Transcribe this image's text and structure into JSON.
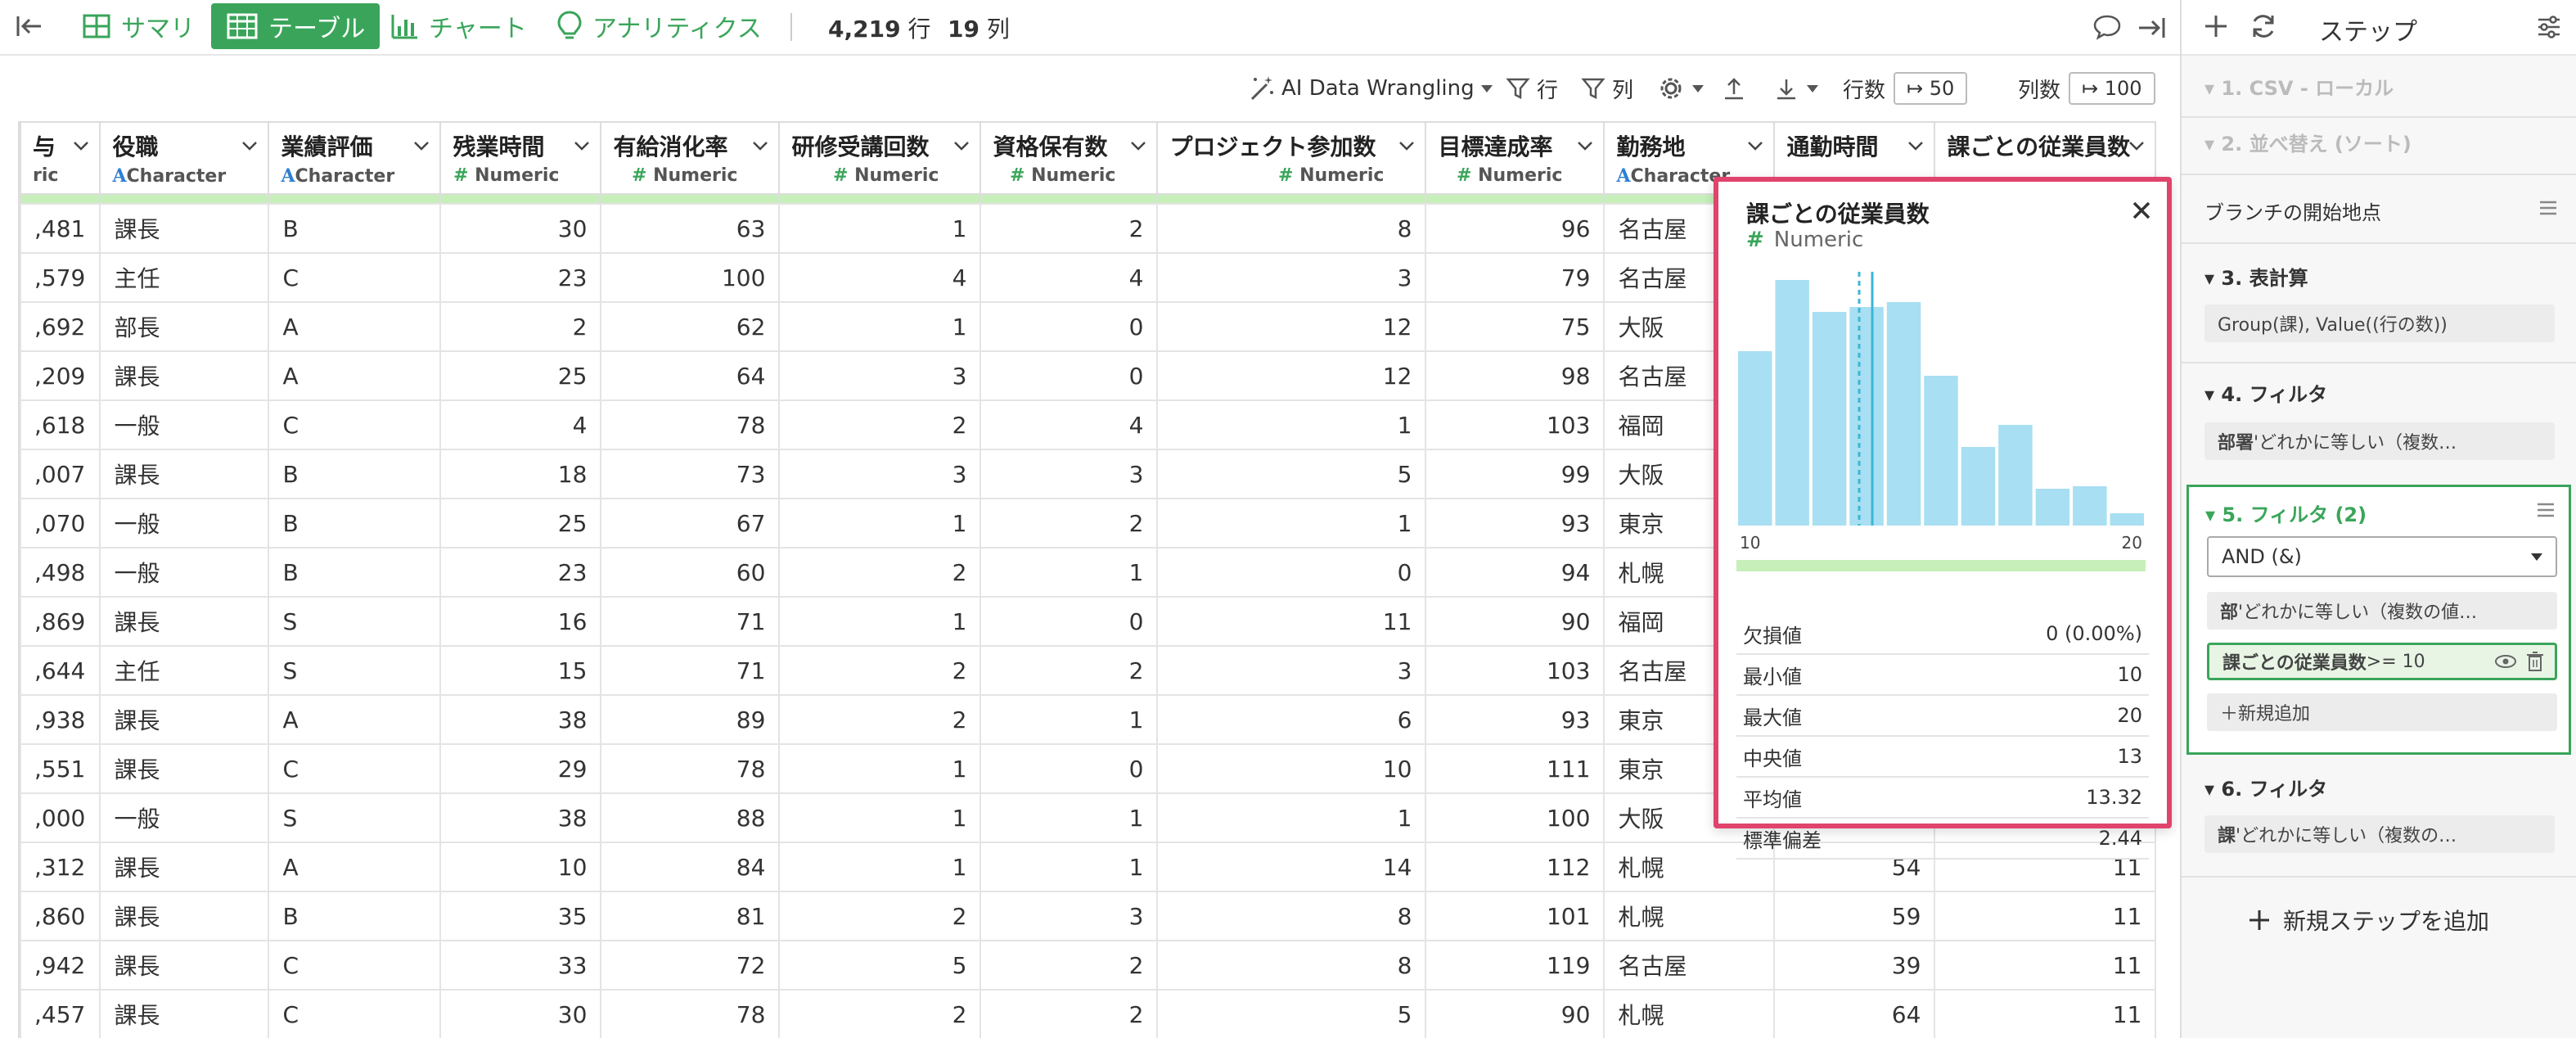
{
  "topbar": {
    "summary": "サマリ",
    "table": "テーブル",
    "chart": "チャート",
    "analytics": "アナリティクス",
    "rows_value": "4,219",
    "rows_unit": "行",
    "cols_value": "19",
    "cols_unit": "列"
  },
  "toolbar": {
    "ai": "AI Data Wrangling",
    "row": "行",
    "col": "列",
    "rows_label": "行数",
    "rows_value": "50",
    "cols_label": "列数",
    "cols_value": "100"
  },
  "columns": [
    {
      "name": "与",
      "type": "ric",
      "kind": "N"
    },
    {
      "name": "役職",
      "type": "Character",
      "kind": "A"
    },
    {
      "name": "業績評価",
      "type": "Character",
      "kind": "A"
    },
    {
      "name": "残業時間",
      "type": "Numeric",
      "kind": "N"
    },
    {
      "name": "有給消化率",
      "type": "Numeric",
      "kind": "N"
    },
    {
      "name": "研修受講回数",
      "type": "Numeric",
      "kind": "N"
    },
    {
      "name": "資格保有数",
      "type": "Numeric",
      "kind": "N"
    },
    {
      "name": "プロジェクト参加数",
      "type": "Numeric",
      "kind": "N"
    },
    {
      "name": "目標達成率",
      "type": "Numeric",
      "kind": "N"
    },
    {
      "name": "勤務地",
      "type": "Character",
      "kind": "A"
    },
    {
      "name": "通勤時間",
      "type": "",
      "kind": "N"
    },
    {
      "name": "課ごとの従業員数",
      "type": "",
      "kind": "N"
    }
  ],
  "rows": [
    [
      ",481",
      "課長",
      "B",
      "30",
      "63",
      "1",
      "2",
      "8",
      "96",
      "名古屋",
      "",
      ""
    ],
    [
      ",579",
      "主任",
      "C",
      "23",
      "100",
      "4",
      "4",
      "3",
      "79",
      "名古屋",
      "",
      ""
    ],
    [
      ",692",
      "部長",
      "A",
      "2",
      "62",
      "1",
      "0",
      "12",
      "75",
      "大阪",
      "",
      ""
    ],
    [
      ",209",
      "課長",
      "A",
      "25",
      "64",
      "3",
      "0",
      "12",
      "98",
      "名古屋",
      "",
      ""
    ],
    [
      ",618",
      "一般",
      "C",
      "4",
      "78",
      "2",
      "4",
      "1",
      "103",
      "福岡",
      "",
      ""
    ],
    [
      ",007",
      "課長",
      "B",
      "18",
      "73",
      "3",
      "3",
      "5",
      "99",
      "大阪",
      "",
      ""
    ],
    [
      ",070",
      "一般",
      "B",
      "25",
      "67",
      "1",
      "2",
      "1",
      "93",
      "東京",
      "",
      ""
    ],
    [
      ",498",
      "一般",
      "B",
      "23",
      "60",
      "2",
      "1",
      "0",
      "94",
      "札幌",
      "",
      ""
    ],
    [
      ",869",
      "課長",
      "S",
      "16",
      "71",
      "1",
      "0",
      "11",
      "90",
      "福岡",
      "",
      ""
    ],
    [
      ",644",
      "主任",
      "S",
      "15",
      "71",
      "2",
      "2",
      "3",
      "103",
      "名古屋",
      "",
      ""
    ],
    [
      ",938",
      "課長",
      "A",
      "38",
      "89",
      "2",
      "1",
      "6",
      "93",
      "東京",
      "",
      ""
    ],
    [
      ",551",
      "課長",
      "C",
      "29",
      "78",
      "1",
      "0",
      "10",
      "111",
      "東京",
      "",
      ""
    ],
    [
      ",000",
      "一般",
      "S",
      "38",
      "88",
      "1",
      "1",
      "1",
      "100",
      "大阪",
      "",
      ""
    ],
    [
      ",312",
      "課長",
      "A",
      "10",
      "84",
      "1",
      "1",
      "14",
      "112",
      "札幌",
      "54",
      "11"
    ],
    [
      ",860",
      "課長",
      "B",
      "35",
      "81",
      "2",
      "3",
      "8",
      "101",
      "札幌",
      "59",
      "11"
    ],
    [
      ",942",
      "課長",
      "C",
      "33",
      "72",
      "5",
      "2",
      "8",
      "119",
      "名古屋",
      "39",
      "11"
    ],
    [
      ",457",
      "課長",
      "C",
      "30",
      "78",
      "2",
      "2",
      "5",
      "90",
      "札幌",
      "64",
      "11"
    ]
  ],
  "popup": {
    "title": "課ごとの従業員数",
    "type": "Numeric",
    "stats": [
      {
        "label": "欠損値",
        "value": "0 (0.00%)"
      },
      {
        "label": "最小値",
        "value": "10"
      },
      {
        "label": "最大値",
        "value": "20"
      },
      {
        "label": "中央値",
        "value": "13"
      },
      {
        "label": "平均値",
        "value": "13.32"
      },
      {
        "label": "標準偏差",
        "value": "2.44"
      }
    ]
  },
  "chart_data": {
    "type": "bar",
    "title": "",
    "xlim": [
      10,
      20
    ],
    "tick_labels": [
      "10",
      "20"
    ],
    "values": [
      0.71,
      1.0,
      0.87,
      0.89,
      0.91,
      0.61,
      0.32,
      0.41,
      0.15,
      0.16,
      0.05
    ],
    "median": 13,
    "mean": 13.32,
    "color": "#a8dff2"
  },
  "panel": {
    "title": "ステップ",
    "step1": "1. CSV - ローカル",
    "step2": "2. 並べ替え (ソート)",
    "branch": "ブランチの開始地点",
    "step3": "3. 表計算",
    "step3_detail": "Group(課), Value((行の数))",
    "step4": "4. フィルタ",
    "step4_key": "部署",
    "step4_detail": " 'どれかに等しい（複数…",
    "step5": "5. フィルタ (2)",
    "step5_select": "AND (&)",
    "step5_c1_key": "部",
    "step5_c1_detail": " 'どれかに等しい（複数の値…",
    "step5_c2_key": "課ごとの従業員数",
    "step5_c2_detail": " >= 10",
    "step5_add": "＋新規追加",
    "step6": "6. フィルタ",
    "step6_key": "課",
    "step6_detail": " 'どれかに等しい（複数の…",
    "add_step": "新規ステップを追加"
  }
}
